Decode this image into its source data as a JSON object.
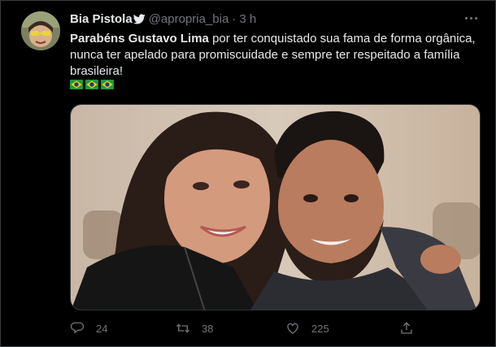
{
  "tweet": {
    "author_name": "Bia Pistola",
    "handle": "@apropria_bia",
    "separator": "·",
    "time": "3 h",
    "text_bold": "Parabéns Gustavo Lima",
    "text_rest": " por ter conquistado sua fama de forma orgânica, nunca ter apelado para promiscuidade e sempre ter respeitado a família brasileira!",
    "flags": [
      "brazil-flag-emoji",
      "brazil-flag-emoji",
      "brazil-flag-emoji"
    ]
  },
  "actions": {
    "replies": "24",
    "retweets": "38",
    "likes": "225"
  },
  "colors": {
    "background": "#000000",
    "text": "#e7e9ea",
    "muted": "#71767b",
    "border": "#2f3336"
  }
}
